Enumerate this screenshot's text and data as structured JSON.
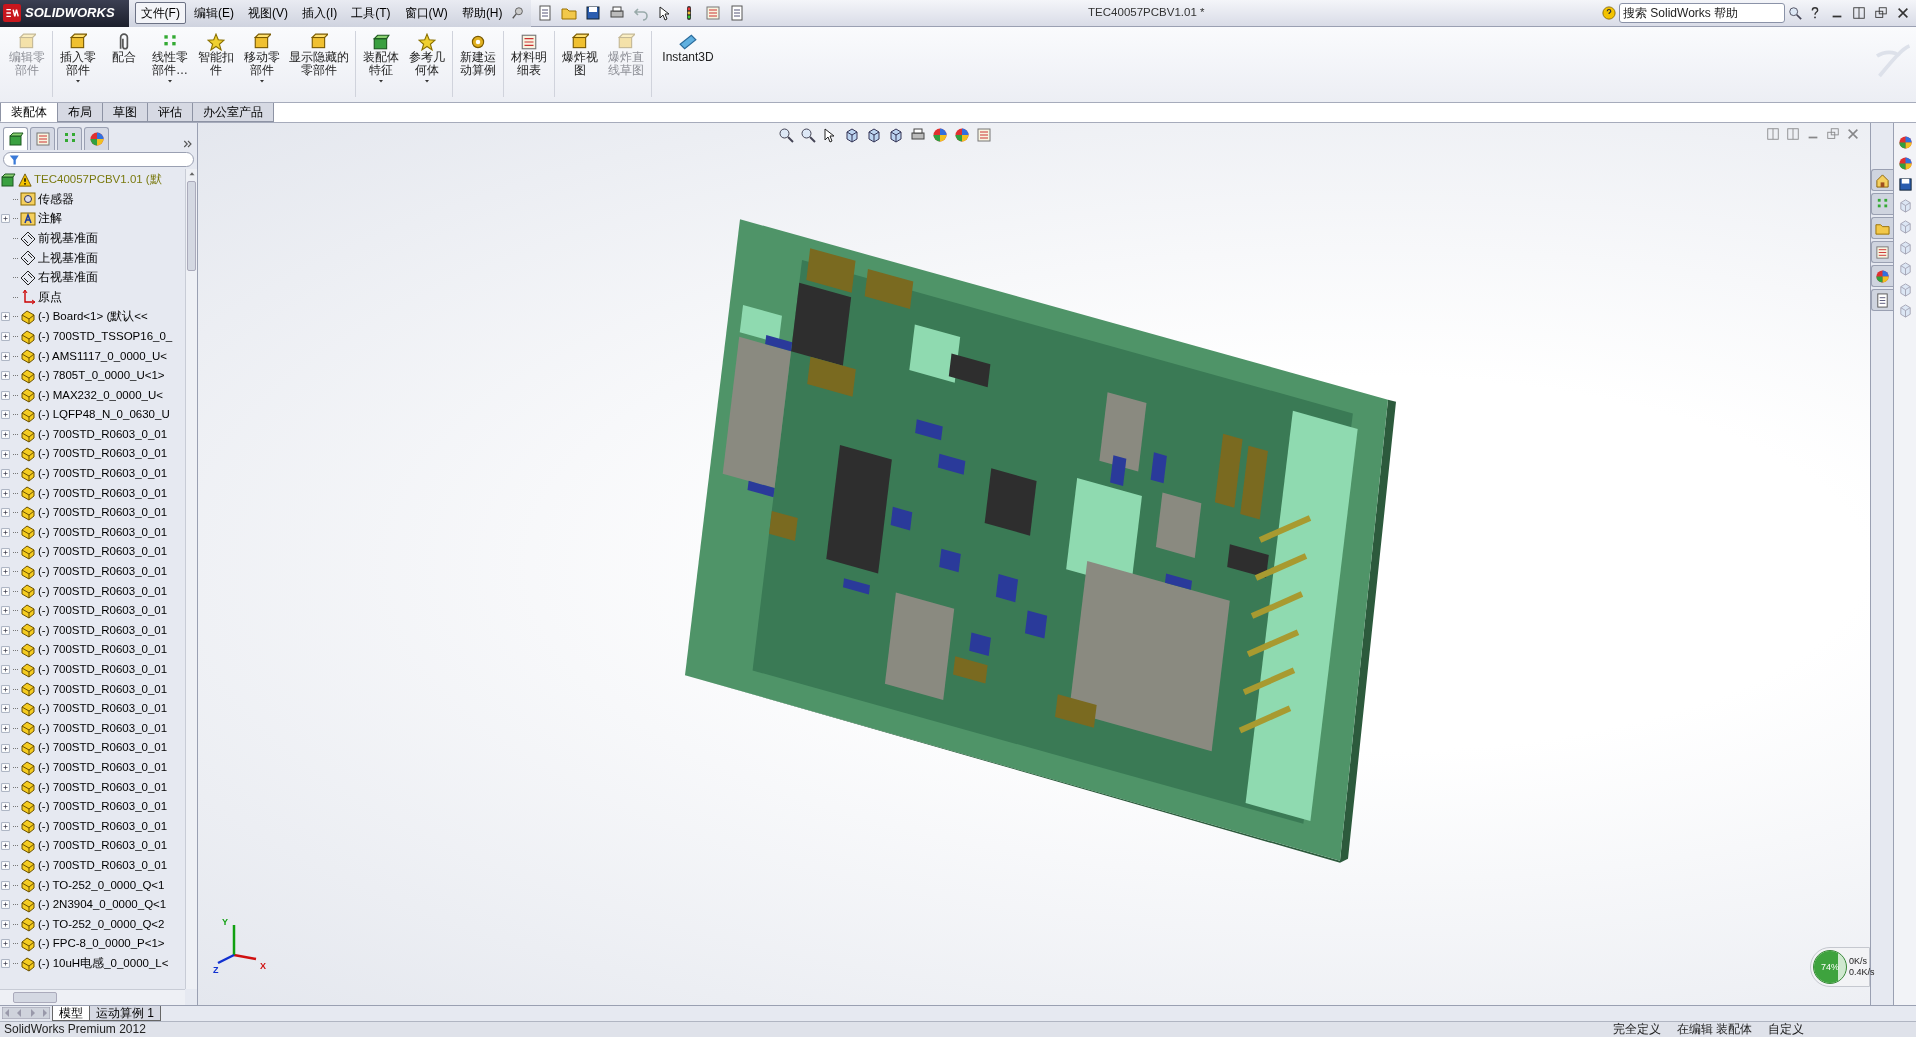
{
  "window": {
    "app_name": "SOLIDWORKS",
    "title": "TEC40057PCBV1.01 *"
  },
  "menu": [
    {
      "label": "文件(F)",
      "selected": true
    },
    {
      "label": "编辑(E)",
      "selected": false
    },
    {
      "label": "视图(V)",
      "selected": false
    },
    {
      "label": "插入(I)",
      "selected": false
    },
    {
      "label": "工具(T)",
      "selected": false
    },
    {
      "label": "窗口(W)",
      "selected": false
    },
    {
      "label": "帮助(H)",
      "selected": false
    }
  ],
  "search": {
    "placeholder": "搜索 SolidWorks 帮助"
  },
  "ribbon": [
    {
      "label": "编辑零部件",
      "disabled": true,
      "dropdown": false
    },
    {
      "label": "插入零部件",
      "disabled": false,
      "dropdown": true
    },
    {
      "label": "配合",
      "disabled": false,
      "dropdown": false
    },
    {
      "label": "线性零部件…",
      "disabled": false,
      "dropdown": true
    },
    {
      "label": "智能扣件",
      "disabled": false,
      "dropdown": false
    },
    {
      "label": "移动零部件",
      "disabled": false,
      "dropdown": true
    },
    {
      "label": "显示隐藏的零部件",
      "disabled": false,
      "dropdown": false
    },
    {
      "label": "装配体特征",
      "disabled": false,
      "dropdown": true
    },
    {
      "label": "参考几何体",
      "disabled": false,
      "dropdown": true
    },
    {
      "label": "新建运动算例",
      "disabled": false,
      "dropdown": false
    },
    {
      "label": "材料明细表",
      "disabled": false,
      "dropdown": false
    },
    {
      "label": "爆炸视图",
      "disabled": false,
      "dropdown": false
    },
    {
      "label": "爆炸直线草图",
      "disabled": true,
      "dropdown": false
    },
    {
      "label": "Instant3D",
      "disabled": false,
      "dropdown": false
    }
  ],
  "command_tabs": [
    {
      "label": "装配体",
      "selected": true
    },
    {
      "label": "布局",
      "selected": false
    },
    {
      "label": "草图",
      "selected": false
    },
    {
      "label": "评估",
      "selected": false
    },
    {
      "label": "办公室产品",
      "selected": false
    }
  ],
  "feature_tree": {
    "root": {
      "label": "TEC40057PCBV1.01 (默",
      "warning": true
    },
    "items": [
      {
        "kind": "sensors",
        "label": "传感器",
        "expandable": false
      },
      {
        "kind": "annotations",
        "label": "注解",
        "expandable": true
      },
      {
        "kind": "plane",
        "label": "前视基准面",
        "expandable": false
      },
      {
        "kind": "plane",
        "label": "上视基准面",
        "expandable": false
      },
      {
        "kind": "plane",
        "label": "右视基准面",
        "expandable": false
      },
      {
        "kind": "origin",
        "label": "原点",
        "expandable": false
      },
      {
        "kind": "part",
        "label": "(-) Board<1> (默认<<",
        "expandable": true
      },
      {
        "kind": "part",
        "label": "(-) 700STD_TSSOP16_0_",
        "expandable": true
      },
      {
        "kind": "part",
        "label": "(-) AMS1117_0_0000_U<",
        "expandable": true
      },
      {
        "kind": "part",
        "label": "(-) 7805T_0_0000_U<1>",
        "expandable": true
      },
      {
        "kind": "part",
        "label": "(-) MAX232_0_0000_U<",
        "expandable": true
      },
      {
        "kind": "part",
        "label": "(-) LQFP48_N_0_0630_U",
        "expandable": true
      },
      {
        "kind": "part",
        "label": "(-) 700STD_R0603_0_01",
        "expandable": true
      },
      {
        "kind": "part",
        "label": "(-) 700STD_R0603_0_01",
        "expandable": true
      },
      {
        "kind": "part",
        "label": "(-) 700STD_R0603_0_01",
        "expandable": true
      },
      {
        "kind": "part",
        "label": "(-) 700STD_R0603_0_01",
        "expandable": true
      },
      {
        "kind": "part",
        "label": "(-) 700STD_R0603_0_01",
        "expandable": true
      },
      {
        "kind": "part",
        "label": "(-) 700STD_R0603_0_01",
        "expandable": true
      },
      {
        "kind": "part",
        "label": "(-) 700STD_R0603_0_01",
        "expandable": true
      },
      {
        "kind": "part",
        "label": "(-) 700STD_R0603_0_01",
        "expandable": true
      },
      {
        "kind": "part",
        "label": "(-) 700STD_R0603_0_01",
        "expandable": true
      },
      {
        "kind": "part",
        "label": "(-) 700STD_R0603_0_01",
        "expandable": true
      },
      {
        "kind": "part",
        "label": "(-) 700STD_R0603_0_01",
        "expandable": true
      },
      {
        "kind": "part",
        "label": "(-) 700STD_R0603_0_01",
        "expandable": true
      },
      {
        "kind": "part",
        "label": "(-) 700STD_R0603_0_01",
        "expandable": true
      },
      {
        "kind": "part",
        "label": "(-) 700STD_R0603_0_01",
        "expandable": true
      },
      {
        "kind": "part",
        "label": "(-) 700STD_R0603_0_01",
        "expandable": true
      },
      {
        "kind": "part",
        "label": "(-) 700STD_R0603_0_01",
        "expandable": true
      },
      {
        "kind": "part",
        "label": "(-) 700STD_R0603_0_01",
        "expandable": true
      },
      {
        "kind": "part",
        "label": "(-) 700STD_R0603_0_01",
        "expandable": true
      },
      {
        "kind": "part",
        "label": "(-) 700STD_R0603_0_01",
        "expandable": true
      },
      {
        "kind": "part",
        "label": "(-) 700STD_R0603_0_01",
        "expandable": true
      },
      {
        "kind": "part",
        "label": "(-) 700STD_R0603_0_01",
        "expandable": true
      },
      {
        "kind": "part",
        "label": "(-) 700STD_R0603_0_01",
        "expandable": true
      },
      {
        "kind": "part",
        "label": "(-) 700STD_R0603_0_01",
        "expandable": true
      },
      {
        "kind": "part",
        "label": "(-) TO-252_0_0000_Q<1",
        "expandable": true
      },
      {
        "kind": "part",
        "label": "(-) 2N3904_0_0000_Q<1",
        "expandable": true
      },
      {
        "kind": "part",
        "label": "(-) TO-252_0_0000_Q<2",
        "expandable": true
      },
      {
        "kind": "part",
        "label": "(-) FPC-8_0_0000_P<1>",
        "expandable": true
      },
      {
        "kind": "part",
        "label": "(-) 10uH电感_0_0000_L<",
        "expandable": true
      }
    ]
  },
  "pane_tabs": [
    {
      "selected": true
    },
    {
      "selected": false
    },
    {
      "selected": false
    },
    {
      "selected": false
    }
  ],
  "viewport": {
    "triad": [
      "X",
      "Y",
      "Z"
    ]
  },
  "bottom_tabs": [
    {
      "label": "模型",
      "selected": true
    },
    {
      "label": "运动算例 1",
      "selected": false
    }
  ],
  "status_bar": [
    "SolidWorks Premium 2012",
    "完全定义",
    "在编辑 装配体",
    "自定义"
  ],
  "speed_meter": {
    "percent": "74%",
    "level": 0.74,
    "upload": "0K/s",
    "download": "0.4K/s"
  }
}
